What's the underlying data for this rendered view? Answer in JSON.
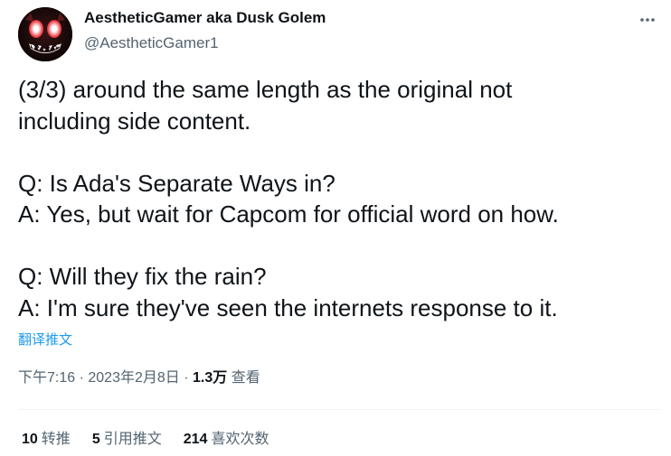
{
  "author": {
    "display_name": "AestheticGamer aka Dusk Golem",
    "handle": "@AestheticGamer1",
    "avatar_icon": "skull-face-avatar"
  },
  "more_icon": "more-horizontal-icon",
  "tweet": {
    "lines": [
      "(3/3) around the same length as the original not",
      "including side content.",
      "",
      "Q: Is Ada's Separate Ways in?",
      "A: Yes, but wait for Capcom for official word on how.",
      "",
      "Q: Will they fix the rain?",
      "A: I'm sure they've seen the internets response to it."
    ],
    "translate_label": "翻译推文"
  },
  "meta": {
    "time": "下午7:16",
    "separator1": " · ",
    "date": "2023年2月8日",
    "separator2": " · ",
    "views_count": "1.3万",
    "views_label": " 查看"
  },
  "stats": {
    "retweets": {
      "count": "10",
      "label": "转推"
    },
    "quotes": {
      "count": "5",
      "label": "引用推文"
    },
    "likes": {
      "count": "214",
      "label": "喜欢次数"
    }
  },
  "colors": {
    "text": "#0f1419",
    "secondary": "#536471",
    "link": "#1d9bf0",
    "divider": "#eff3f4"
  }
}
